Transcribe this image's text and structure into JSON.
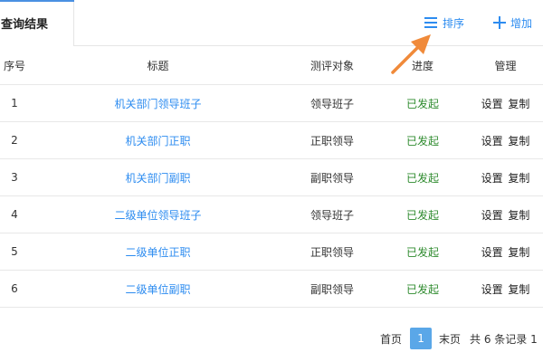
{
  "tabs": {
    "active": "查询结果"
  },
  "toolbar": {
    "sort_label": "排序",
    "add_label": "增加"
  },
  "icons": {
    "sort": "list-icon",
    "add": "plus-icon",
    "arrow": "arrow-annotation"
  },
  "colors": {
    "accent": "#2d8cf0",
    "status_green": "#2e8b2e",
    "arrow_orange": "#f08a3a",
    "page_active": "#5aa7e8"
  },
  "table": {
    "headers": {
      "index": "序号",
      "title": "标题",
      "target": "测评对象",
      "status": "进度",
      "ops": "管理"
    },
    "rows": [
      {
        "index": "1",
        "title": "机关部门领导班子",
        "target": "领导班子",
        "status": "已发起",
        "op_set": "设置",
        "op_copy": "复制"
      },
      {
        "index": "2",
        "title": "机关部门正职",
        "target": "正职领导",
        "status": "已发起",
        "op_set": "设置",
        "op_copy": "复制"
      },
      {
        "index": "3",
        "title": "机关部门副职",
        "target": "副职领导",
        "status": "已发起",
        "op_set": "设置",
        "op_copy": "复制"
      },
      {
        "index": "4",
        "title": "二级单位领导班子",
        "target": "领导班子",
        "status": "已发起",
        "op_set": "设置",
        "op_copy": "复制"
      },
      {
        "index": "5",
        "title": "二级单位正职",
        "target": "正职领导",
        "status": "已发起",
        "op_set": "设置",
        "op_copy": "复制"
      },
      {
        "index": "6",
        "title": "二级单位副职",
        "target": "副职领导",
        "status": "已发起",
        "op_set": "设置",
        "op_copy": "复制"
      }
    ]
  },
  "pagination": {
    "first": "首页",
    "current": "1",
    "last": "末页",
    "total": "共 6 条记录 1"
  }
}
